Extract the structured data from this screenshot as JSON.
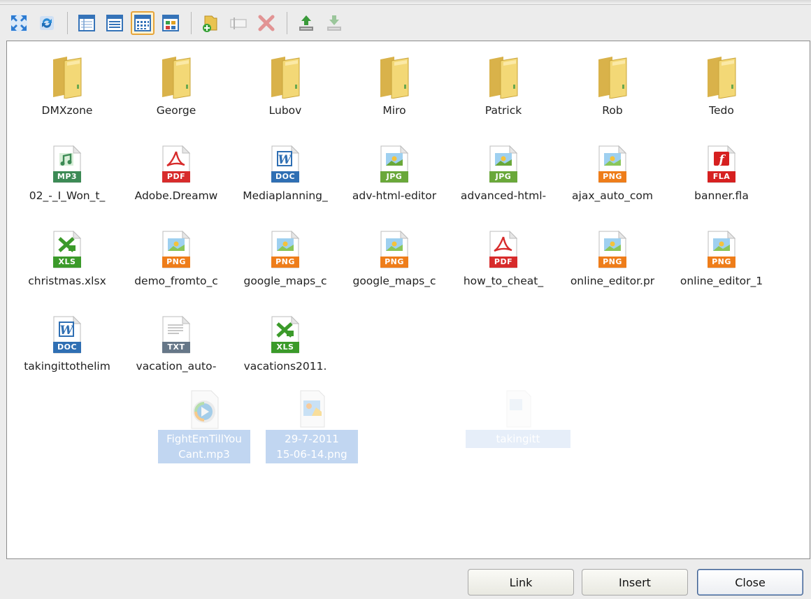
{
  "toolbar": {
    "buttons": [
      {
        "name": "fullscreen-icon",
        "state": "normal"
      },
      {
        "name": "refresh-icon",
        "state": "normal"
      },
      {
        "name": "details-view-icon",
        "state": "normal"
      },
      {
        "name": "list-view-icon",
        "state": "normal"
      },
      {
        "name": "small-icons-view-icon",
        "state": "active"
      },
      {
        "name": "large-icons-view-icon",
        "state": "normal"
      },
      {
        "name": "new-folder-icon",
        "state": "normal"
      },
      {
        "name": "rename-icon",
        "state": "disabled"
      },
      {
        "name": "delete-icon",
        "state": "disabled"
      },
      {
        "name": "upload-icon",
        "state": "normal"
      },
      {
        "name": "download-icon",
        "state": "disabled"
      }
    ]
  },
  "folders": [
    {
      "label": "DMXzone"
    },
    {
      "label": "George"
    },
    {
      "label": "Lubov"
    },
    {
      "label": "Miro"
    },
    {
      "label": "Patrick"
    },
    {
      "label": "Rob"
    },
    {
      "label": "Tedo"
    }
  ],
  "files": [
    {
      "label": "02_-_I_Won_t_",
      "type": "MP3",
      "color": "#3c8a55",
      "icon": "music-file-icon"
    },
    {
      "label": "Adobe.Dreamw",
      "type": "PDF",
      "color": "#d72b2b",
      "icon": "pdf-file-icon"
    },
    {
      "label": "Mediaplanning_",
      "type": "DOC",
      "color": "#2f6fb3",
      "icon": "word-file-icon"
    },
    {
      "label": "adv-html-editor",
      "type": "JPG",
      "color": "#6aa83a",
      "icon": "image-file-icon"
    },
    {
      "label": "advanced-html-",
      "type": "JPG",
      "color": "#6aa83a",
      "icon": "image-file-icon"
    },
    {
      "label": "ajax_auto_com",
      "type": "PNG",
      "color": "#ee7d1a",
      "icon": "image-file-icon"
    },
    {
      "label": "banner.fla",
      "type": "FLA",
      "color": "#d62020",
      "icon": "flash-file-icon"
    },
    {
      "label": "christmas.xlsx",
      "type": "XLS",
      "color": "#3b9a2a",
      "icon": "excel-file-icon"
    },
    {
      "label": "demo_fromto_c",
      "type": "PNG",
      "color": "#ee7d1a",
      "icon": "image-file-icon"
    },
    {
      "label": "google_maps_c",
      "type": "PNG",
      "color": "#ee7d1a",
      "icon": "image-file-icon"
    },
    {
      "label": "google_maps_c",
      "type": "PNG",
      "color": "#ee7d1a",
      "icon": "image-file-icon"
    },
    {
      "label": "how_to_cheat_",
      "type": "PDF",
      "color": "#d72b2b",
      "icon": "pdf-file-icon"
    },
    {
      "label": "online_editor.pr",
      "type": "PNG",
      "color": "#ee7d1a",
      "icon": "image-file-icon"
    },
    {
      "label": "online_editor_1",
      "type": "PNG",
      "color": "#ee7d1a",
      "icon": "image-file-icon"
    },
    {
      "label": "takingittothelim",
      "type": "DOC",
      "color": "#2f6fb3",
      "icon": "word-file-icon"
    },
    {
      "label": "vacation_auto-",
      "type": "TXT",
      "color": "#667788",
      "icon": "text-file-icon"
    },
    {
      "label": "vacations2011.",
      "type": "XLS",
      "color": "#3b9a2a",
      "icon": "excel-file-icon"
    }
  ],
  "drag_items": [
    {
      "label_line1": "FightEmTillYou",
      "label_line2": "Cant.mp3",
      "icon": "media-file-icon"
    },
    {
      "label_line1": "29-7-2011",
      "label_line2": "15-06-14.png",
      "icon": "image-file-icon"
    },
    {
      "label_line1": "takingitt",
      "label_line2": "",
      "icon": "word-file-icon"
    }
  ],
  "buttons": {
    "link": "Link",
    "insert": "Insert",
    "close": "Close"
  }
}
